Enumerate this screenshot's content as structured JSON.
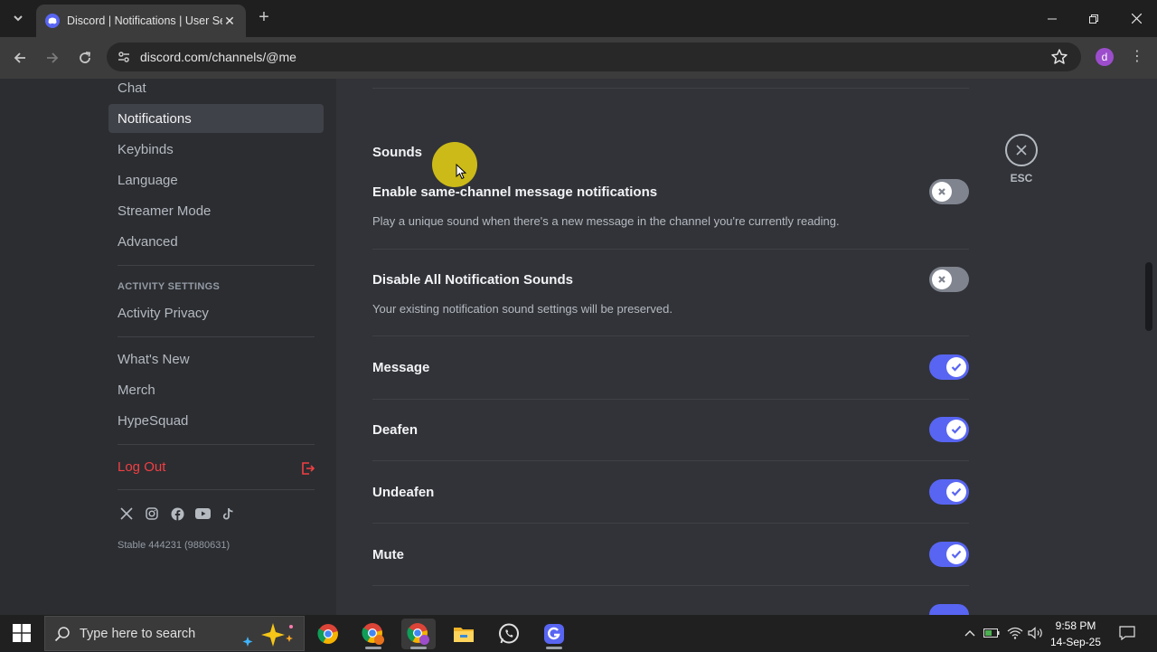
{
  "browser": {
    "tab_title": "Discord | Notifications | User Se",
    "url": "discord.com/channels/@me",
    "profile_initial": "d"
  },
  "sidebar": {
    "items_top": [
      "Chat",
      "Notifications",
      "Keybinds",
      "Language",
      "Streamer Mode",
      "Advanced"
    ],
    "active_item": "Notifications",
    "activity_header": "ACTIVITY SETTINGS",
    "activity_privacy": "Activity Privacy",
    "items_misc": [
      "What's New",
      "Merch",
      "HypeSquad"
    ],
    "logout": "Log Out",
    "version": "Stable 444231 (9880631)",
    "social_icons": [
      "x-icon",
      "instagram-icon",
      "facebook-icon",
      "youtube-icon",
      "tiktok-icon"
    ]
  },
  "main": {
    "section_title": "Sounds",
    "esc_label": "ESC",
    "rows": [
      {
        "title": "Enable same-channel message notifications",
        "desc": "Play a unique sound when there's a new message in the channel you're currently reading.",
        "on": false
      },
      {
        "title": "Disable All Notification Sounds",
        "desc": "Your existing notification sound settings will be preserved.",
        "on": false
      },
      {
        "title": "Message",
        "on": true
      },
      {
        "title": "Deafen",
        "on": true
      },
      {
        "title": "Undeafen",
        "on": true
      },
      {
        "title": "Mute",
        "on": true
      }
    ]
  },
  "taskbar": {
    "search_placeholder": "Type here to search",
    "time": "9:58 PM",
    "date": "14-Sep-25"
  },
  "colors": {
    "accent": "#5865f2",
    "logout": "#f23f43"
  }
}
